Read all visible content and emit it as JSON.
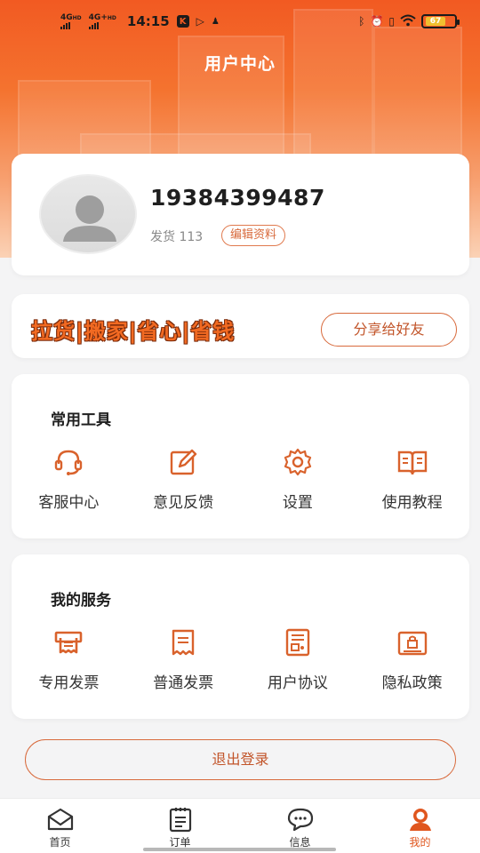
{
  "status_bar": {
    "signal1": "4G",
    "signal1_hd": "HD",
    "signal2": "4G+",
    "signal2_hd": "HD",
    "time": "14:15",
    "battery": "67"
  },
  "header": {
    "title": "用户中心"
  },
  "profile": {
    "phone": "19384399487",
    "ship_label": "发货 113",
    "edit_label": "编辑资料"
  },
  "promo": {
    "slogan": "拉货|搬家|省心|省钱",
    "share_label": "分享给好友"
  },
  "tools": {
    "title": "常用工具",
    "items": [
      {
        "label": "客服中心",
        "icon": "headset-icon"
      },
      {
        "label": "意见反馈",
        "icon": "feedback-edit-icon"
      },
      {
        "label": "设置",
        "icon": "gear-icon"
      },
      {
        "label": "使用教程",
        "icon": "book-icon"
      }
    ]
  },
  "services": {
    "title": "我的服务",
    "items": [
      {
        "label": "专用发票",
        "icon": "printer-invoice-icon"
      },
      {
        "label": "普通发票",
        "icon": "receipt-icon"
      },
      {
        "label": "用户协议",
        "icon": "document-icon"
      },
      {
        "label": "隐私政策",
        "icon": "privacy-lock-icon"
      }
    ]
  },
  "logout_label": "退出登录",
  "tabbar": {
    "items": [
      {
        "label": "首页",
        "icon": "home-envelope-icon"
      },
      {
        "label": "订单",
        "icon": "clipboard-icon"
      },
      {
        "label": "信息",
        "icon": "chat-bubble-icon"
      },
      {
        "label": "我的",
        "icon": "user-icon"
      }
    ],
    "active": "我的"
  },
  "colors": {
    "brand": "#f25a22",
    "accent_text": "#c2552a",
    "active_tab": "#e0561e"
  }
}
